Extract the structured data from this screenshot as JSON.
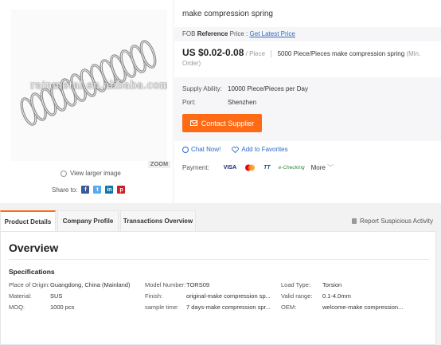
{
  "gallery": {
    "watermark": "rainmetal.en.alibaba.com",
    "zoom_label": "ZOOM",
    "view_larger": "View larger image",
    "share_label": "Share to:",
    "social": [
      {
        "icon": "facebook-icon",
        "glyph": "f",
        "color": "#3b5998"
      },
      {
        "icon": "twitter-icon",
        "glyph": "t",
        "color": "#55acee"
      },
      {
        "icon": "linkedin-icon",
        "glyph": "in",
        "color": "#0e76a8"
      },
      {
        "icon": "pinterest-icon",
        "glyph": "p",
        "color": "#cb2027"
      }
    ]
  },
  "product": {
    "title": "make compression spring",
    "fob_prefix": "FOB",
    "fob_reference": "Reference",
    "fob_price": "Price :",
    "fob_link": "Get Latest Price",
    "price": "US $0.02-0.08",
    "price_unit": "/ Piece",
    "moq": "5000 Piece/Pieces make compression spring",
    "moq_note": "(Min. Order)",
    "supply_label": "Supply Ability:",
    "supply_value": "10000 Piece/Pieces per Day",
    "port_label": "Port:",
    "port_value": "Shenzhen",
    "contact_button": "Contact Supplier",
    "chat_now": "Chat Now!",
    "add_favorites": "Add to Favorites",
    "payment_label": "Payment:",
    "payment_methods": [
      "VISA",
      "MC",
      "TT",
      "e-Checking"
    ],
    "more": "More"
  },
  "colors": {
    "accent": "#ff6a14",
    "link": "#2b6cc4"
  },
  "tabs": [
    {
      "label": "Product Details",
      "active": true
    },
    {
      "label": "Company Profile",
      "active": false
    },
    {
      "label": "Transactions Overview",
      "active": false
    }
  ],
  "report": "Report Suspicious Activity",
  "overview": {
    "title": "Overview",
    "spec_title": "Specifications",
    "attributes": [
      {
        "label": "Place of Origin:",
        "value": "Guangdong, China (Mainland)"
      },
      {
        "label": "Model Number:",
        "value": "TORS09"
      },
      {
        "label": "Load Type:",
        "value": "Torsion"
      },
      {
        "label": "Material:",
        "value": "SUS"
      },
      {
        "label": "Finish:",
        "value": "original-make compression sp..."
      },
      {
        "label": "Valid range:",
        "value": "0.1-4.0mm"
      },
      {
        "label": "MOQ:",
        "value": "1000 pcs"
      },
      {
        "label": "sample time:",
        "value": "7 days-make compression spr..."
      },
      {
        "label": "OEM:",
        "value": "welcome-make compression..."
      }
    ]
  }
}
